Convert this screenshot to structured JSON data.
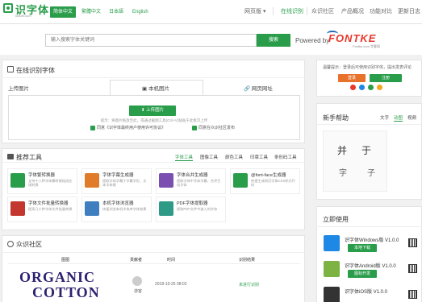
{
  "header": {
    "logo_text": "识字体",
    "logo_sub": "likeziti.com",
    "langs": [
      "简体中文",
      "繁體中文",
      "日本語",
      "English"
    ],
    "nav": [
      "网页版",
      "在线识别",
      "众识社区",
      "产品概况",
      "功能对比",
      "更新日志"
    ],
    "nav_dropdown_glyph": "▾"
  },
  "search": {
    "placeholder": "输入搜索字体关键词",
    "button": "搜索",
    "powered": "Powered by",
    "brand": "FONTKE",
    "brand_sub": "Fontke.com 字客网"
  },
  "recognize": {
    "title": "在线识别字体",
    "tabs": [
      "上传图片",
      "本机图片",
      "网页网址"
    ],
    "upload_button": "上传图片",
    "hint": "提示：将图片拖放至此，或通过截图工具(Ctrl+V)粘贴于此框可上传",
    "check1": "同意《识字体最终用户使用许可协议》",
    "check2": "同意在众识社区发布"
  },
  "tools": {
    "title": "推荐工具",
    "tabs": [
      "字体工具",
      "图像工具",
      "颜色工具",
      "印章工具",
      "条形码工具"
    ],
    "items": [
      {
        "name": "字体繁转换器",
        "desc": "支持十八种字体繁转换组成在线转换",
        "color": "#2a9d4b"
      },
      {
        "name": "字体字幕生成器",
        "desc": "提取字体字幕于字幕字形、文本字体格",
        "color": "#e07b2a"
      },
      {
        "name": "字体合并生成器",
        "desc": "提取字体中字体字幕，合并生成字体",
        "color": "#7a4fb0"
      },
      {
        "name": "@font-face生成器",
        "desc": "快速生成网页字体CSS样式代码",
        "color": "#2a9d4b"
      },
      {
        "name": "字体文件批量转换器",
        "desc": "提高几十种字体文件批量转换",
        "color": "#c4372e"
      },
      {
        "name": "本机字体浏览器",
        "desc": "快速浏览本机字体库字体效果",
        "color": "#3f7fbf"
      },
      {
        "name": "PDF字体提取器",
        "desc": "提取PDF文件中嵌入的字体",
        "color": "#2f9a86"
      }
    ]
  },
  "community": {
    "title": "众识社区",
    "headers": [
      "图图",
      "贡献者",
      "时间",
      "识别结果"
    ],
    "row": {
      "image_line1": "ORGANIC",
      "image_line2": "COTTON",
      "user": "游客",
      "time": "2018-10-25 08:02",
      "result": "未进行识别"
    }
  },
  "login": {
    "text": "温馨提示：登录后可使用识别字体，提出发表评论",
    "login_btn": "登录",
    "register_btn": "注册",
    "social_colors": [
      "#e8382a",
      "#2a9d4b",
      "#1e88e5",
      "#f2a81d"
    ]
  },
  "help": {
    "title": "新手帮助",
    "tabs": [
      "文字",
      "动图",
      "视频"
    ],
    "glyphs": [
      "并",
      "于",
      "字",
      "子"
    ]
  },
  "install": {
    "title": "立即使用",
    "apps": [
      {
        "name": "识字体Windows版 V1.0.0",
        "button": "本地下载",
        "color": "#1e88e5"
      },
      {
        "name": "识字体Android版 V1.0.0",
        "button": "图标开发",
        "color": "#7cb342"
      },
      {
        "name": "识字体iOS版 V1.0.0",
        "button": "",
        "color": "#333333"
      }
    ]
  },
  "colors": {
    "accent": "#2a9d4b",
    "brand_red": "#e8382a"
  }
}
